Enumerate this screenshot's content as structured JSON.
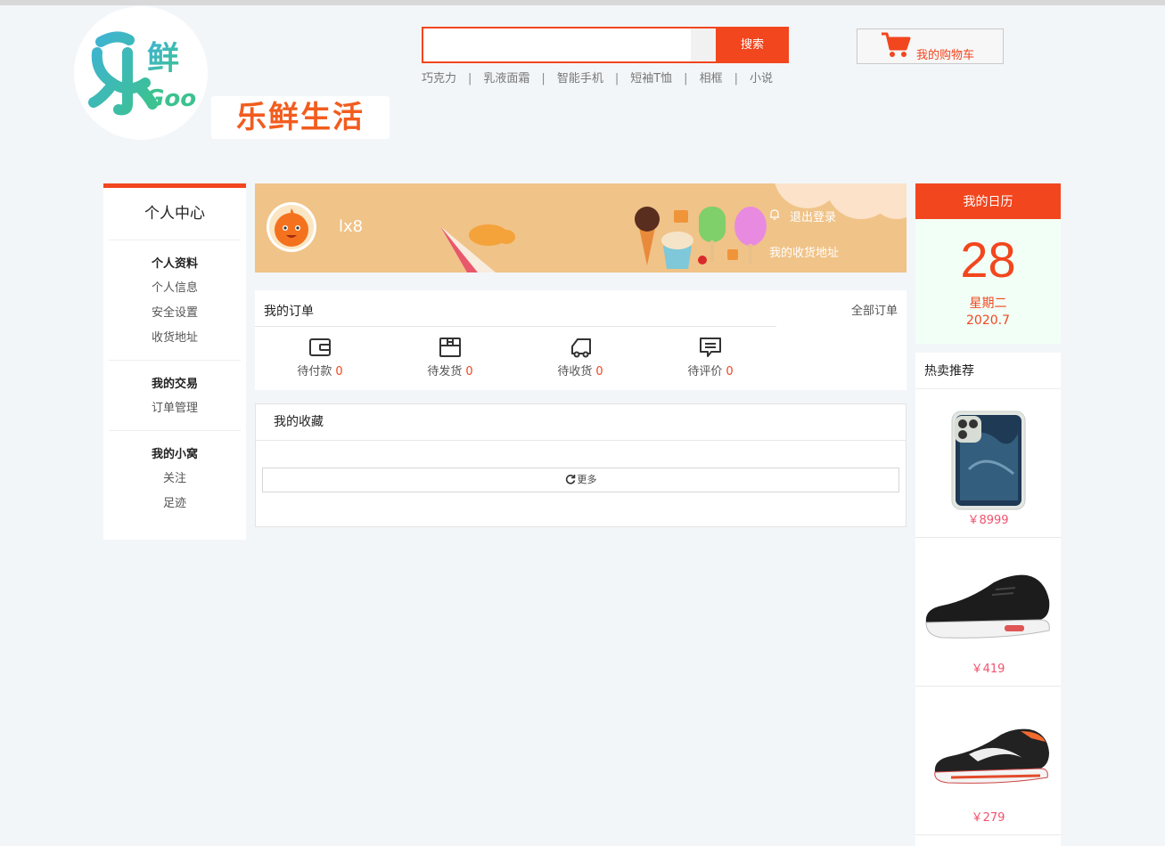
{
  "header": {
    "logo_text": "乐鲜生活",
    "logo_mark": "乐鲜Goo",
    "search": {
      "placeholder": "",
      "button_label": "搜索"
    },
    "hotwords": [
      "巧克力",
      "乳液面霜",
      "智能手机",
      "短袖T恤",
      "相框",
      "小说"
    ],
    "separator": "|",
    "cart_label": "我的购物车",
    "cart_icon": "shopping-cart-icon"
  },
  "sidebar": {
    "title": "个人中心",
    "groups": [
      {
        "head": "个人资料",
        "items": [
          "个人信息",
          "安全设置",
          "收货地址"
        ]
      },
      {
        "head": "我的交易",
        "items": [
          "订单管理"
        ]
      },
      {
        "head": "我的小窝",
        "items": [
          "关注",
          "足迹"
        ]
      }
    ]
  },
  "banner": {
    "username": "lx8",
    "logout_label": "退出登录",
    "address_label": "我的收货地址"
  },
  "orders": {
    "title": "我的订单",
    "all_label": "全部订单",
    "items": [
      {
        "label": "待付款",
        "count": "0",
        "icon": "wallet-icon"
      },
      {
        "label": "待发货",
        "count": "0",
        "icon": "package-icon"
      },
      {
        "label": "待收货",
        "count": "0",
        "icon": "truck-icon"
      },
      {
        "label": "待评价",
        "count": "0",
        "icon": "comment-icon"
      }
    ]
  },
  "favorites": {
    "title": "我的收藏",
    "more_label": "更多"
  },
  "calendar": {
    "title": "我的日历",
    "day": "28",
    "weekday": "星期二",
    "month": "2020.7"
  },
  "hot": {
    "title": "热卖推荐",
    "items": [
      {
        "price": "￥8999"
      },
      {
        "price": "￥419"
      },
      {
        "price": "￥279"
      }
    ]
  },
  "colors": {
    "accent": "#f2461e",
    "banner": "#f0c388",
    "price": "#f2526e",
    "calendar_bg": "#f2fff6"
  }
}
